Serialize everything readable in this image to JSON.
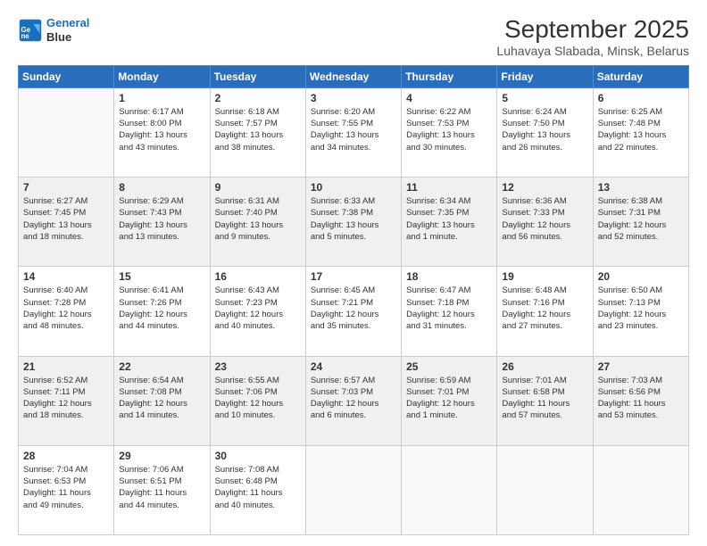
{
  "header": {
    "logo_line1": "General",
    "logo_line2": "Blue",
    "title": "September 2025",
    "subtitle": "Luhavaya Slabada, Minsk, Belarus"
  },
  "days_of_week": [
    "Sunday",
    "Monday",
    "Tuesday",
    "Wednesday",
    "Thursday",
    "Friday",
    "Saturday"
  ],
  "weeks": [
    [
      {
        "day": "",
        "info": ""
      },
      {
        "day": "1",
        "info": "Sunrise: 6:17 AM\nSunset: 8:00 PM\nDaylight: 13 hours\nand 43 minutes."
      },
      {
        "day": "2",
        "info": "Sunrise: 6:18 AM\nSunset: 7:57 PM\nDaylight: 13 hours\nand 38 minutes."
      },
      {
        "day": "3",
        "info": "Sunrise: 6:20 AM\nSunset: 7:55 PM\nDaylight: 13 hours\nand 34 minutes."
      },
      {
        "day": "4",
        "info": "Sunrise: 6:22 AM\nSunset: 7:53 PM\nDaylight: 13 hours\nand 30 minutes."
      },
      {
        "day": "5",
        "info": "Sunrise: 6:24 AM\nSunset: 7:50 PM\nDaylight: 13 hours\nand 26 minutes."
      },
      {
        "day": "6",
        "info": "Sunrise: 6:25 AM\nSunset: 7:48 PM\nDaylight: 13 hours\nand 22 minutes."
      }
    ],
    [
      {
        "day": "7",
        "info": "Sunrise: 6:27 AM\nSunset: 7:45 PM\nDaylight: 13 hours\nand 18 minutes."
      },
      {
        "day": "8",
        "info": "Sunrise: 6:29 AM\nSunset: 7:43 PM\nDaylight: 13 hours\nand 13 minutes."
      },
      {
        "day": "9",
        "info": "Sunrise: 6:31 AM\nSunset: 7:40 PM\nDaylight: 13 hours\nand 9 minutes."
      },
      {
        "day": "10",
        "info": "Sunrise: 6:33 AM\nSunset: 7:38 PM\nDaylight: 13 hours\nand 5 minutes."
      },
      {
        "day": "11",
        "info": "Sunrise: 6:34 AM\nSunset: 7:35 PM\nDaylight: 13 hours\nand 1 minute."
      },
      {
        "day": "12",
        "info": "Sunrise: 6:36 AM\nSunset: 7:33 PM\nDaylight: 12 hours\nand 56 minutes."
      },
      {
        "day": "13",
        "info": "Sunrise: 6:38 AM\nSunset: 7:31 PM\nDaylight: 12 hours\nand 52 minutes."
      }
    ],
    [
      {
        "day": "14",
        "info": "Sunrise: 6:40 AM\nSunset: 7:28 PM\nDaylight: 12 hours\nand 48 minutes."
      },
      {
        "day": "15",
        "info": "Sunrise: 6:41 AM\nSunset: 7:26 PM\nDaylight: 12 hours\nand 44 minutes."
      },
      {
        "day": "16",
        "info": "Sunrise: 6:43 AM\nSunset: 7:23 PM\nDaylight: 12 hours\nand 40 minutes."
      },
      {
        "day": "17",
        "info": "Sunrise: 6:45 AM\nSunset: 7:21 PM\nDaylight: 12 hours\nand 35 minutes."
      },
      {
        "day": "18",
        "info": "Sunrise: 6:47 AM\nSunset: 7:18 PM\nDaylight: 12 hours\nand 31 minutes."
      },
      {
        "day": "19",
        "info": "Sunrise: 6:48 AM\nSunset: 7:16 PM\nDaylight: 12 hours\nand 27 minutes."
      },
      {
        "day": "20",
        "info": "Sunrise: 6:50 AM\nSunset: 7:13 PM\nDaylight: 12 hours\nand 23 minutes."
      }
    ],
    [
      {
        "day": "21",
        "info": "Sunrise: 6:52 AM\nSunset: 7:11 PM\nDaylight: 12 hours\nand 18 minutes."
      },
      {
        "day": "22",
        "info": "Sunrise: 6:54 AM\nSunset: 7:08 PM\nDaylight: 12 hours\nand 14 minutes."
      },
      {
        "day": "23",
        "info": "Sunrise: 6:55 AM\nSunset: 7:06 PM\nDaylight: 12 hours\nand 10 minutes."
      },
      {
        "day": "24",
        "info": "Sunrise: 6:57 AM\nSunset: 7:03 PM\nDaylight: 12 hours\nand 6 minutes."
      },
      {
        "day": "25",
        "info": "Sunrise: 6:59 AM\nSunset: 7:01 PM\nDaylight: 12 hours\nand 1 minute."
      },
      {
        "day": "26",
        "info": "Sunrise: 7:01 AM\nSunset: 6:58 PM\nDaylight: 11 hours\nand 57 minutes."
      },
      {
        "day": "27",
        "info": "Sunrise: 7:03 AM\nSunset: 6:56 PM\nDaylight: 11 hours\nand 53 minutes."
      }
    ],
    [
      {
        "day": "28",
        "info": "Sunrise: 7:04 AM\nSunset: 6:53 PM\nDaylight: 11 hours\nand 49 minutes."
      },
      {
        "day": "29",
        "info": "Sunrise: 7:06 AM\nSunset: 6:51 PM\nDaylight: 11 hours\nand 44 minutes."
      },
      {
        "day": "30",
        "info": "Sunrise: 7:08 AM\nSunset: 6:48 PM\nDaylight: 11 hours\nand 40 minutes."
      },
      {
        "day": "",
        "info": ""
      },
      {
        "day": "",
        "info": ""
      },
      {
        "day": "",
        "info": ""
      },
      {
        "day": "",
        "info": ""
      }
    ]
  ]
}
